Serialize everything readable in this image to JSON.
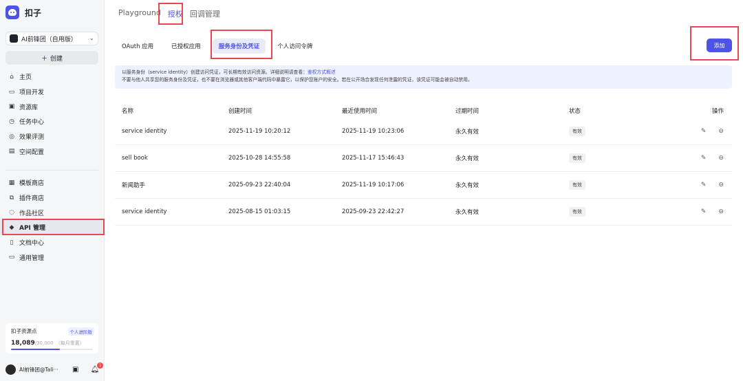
{
  "app": {
    "name": "扣子"
  },
  "workspace": {
    "name": "AI前锋团（自用版）"
  },
  "create_button": {
    "icon": "plus-icon",
    "label": "创建"
  },
  "nav_primary": [
    {
      "label": "主页",
      "icon": "home-icon"
    },
    {
      "label": "项目开发",
      "icon": "project-icon"
    },
    {
      "label": "资源库",
      "icon": "library-icon"
    },
    {
      "label": "任务中心",
      "icon": "task-icon"
    },
    {
      "label": "效果评测",
      "icon": "eval-icon"
    },
    {
      "label": "空间配置",
      "icon": "settings-folder-icon"
    }
  ],
  "nav_secondary": [
    {
      "label": "模板商店",
      "icon": "template-icon"
    },
    {
      "label": "插件商店",
      "icon": "plugin-icon"
    },
    {
      "label": "作品社区",
      "icon": "community-icon"
    },
    {
      "label": "API 管理",
      "icon": "api-icon",
      "active": true
    },
    {
      "label": "文档中心",
      "icon": "doc-icon"
    },
    {
      "label": "通用管理",
      "icon": "manage-icon"
    }
  ],
  "resource_card": {
    "title": "扣子资源点",
    "tag": "个人进阶版",
    "used": "18,089",
    "total": "/30,000",
    "note": "（每月重置）",
    "fill_fraction": 0.6
  },
  "user": {
    "name": "AI前锋团@Tali···",
    "badge": "1"
  },
  "top_tabs": [
    {
      "label": "Playground",
      "active": false
    },
    {
      "label": "授权",
      "active": true
    },
    {
      "label": "回调管理",
      "active": false
    }
  ],
  "sub_tabs": [
    {
      "label": "OAuth 应用",
      "active": false
    },
    {
      "label": "已授权应用",
      "active": false
    },
    {
      "label": "服务身份及凭证",
      "active": true
    },
    {
      "label": "个人访问令牌",
      "active": false
    }
  ],
  "add_button": {
    "label": "添加"
  },
  "notice": {
    "line1_prefix": "以服务身份（service identity）创建访问凭证，可长期有效访问资源。详细说明请查看：",
    "line1_link": "鉴权方式概述",
    "line2": "不要与他人共享您的服务身份及凭证，也不要在浏览器或其他客户端代码中暴露它，以保护您账户的安全。若在公开场合发现任何泄露的凭证，该凭证可能会被自动禁用。"
  },
  "table": {
    "headers": [
      "名称",
      "创建时间",
      "最近使用时间",
      "过期时间",
      "状态",
      "操作"
    ],
    "rows": [
      {
        "name": "service identity",
        "created": "2025-11-19 10:20:12",
        "last_used": "2025-11-19 10:23:06",
        "expires": "永久有效",
        "status": "有效"
      },
      {
        "name": "sell book",
        "created": "2025-10-28 14:55:58",
        "last_used": "2025-11-17 15:46:43",
        "expires": "永久有效",
        "status": "有效"
      },
      {
        "name": "新闻助手",
        "created": "2025-09-23 22:40:04",
        "last_used": "2025-11-19 10:17:06",
        "expires": "永久有效",
        "status": "有效"
      },
      {
        "name": "service identity",
        "created": "2025-08-15 01:03:15",
        "last_used": "2025-09-23 22:42:27",
        "expires": "永久有效",
        "status": "有效"
      }
    ]
  },
  "colors": {
    "accent": "#4d53e8",
    "highlight": "#e8484d"
  }
}
